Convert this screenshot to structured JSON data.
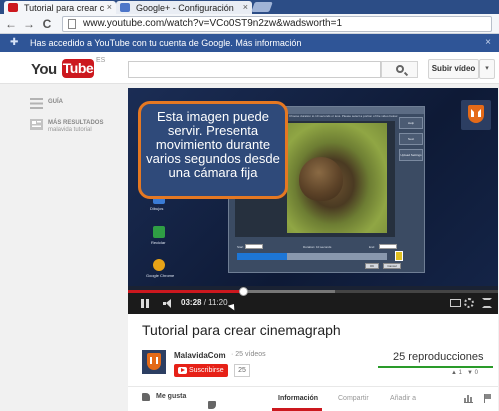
{
  "browser": {
    "tabs": [
      {
        "title": "Tutorial para crear c",
        "favicon_color": "#cc181e",
        "active": true
      },
      {
        "title": "Google+ - Configuración",
        "favicon_color": "#4d76c9",
        "active": false
      }
    ],
    "close_glyph": "×",
    "back_glyph": "←",
    "forward_glyph": "→",
    "reload_glyph": "C",
    "url": "www.youtube.com/watch?v=VCo0ST9n2zw&wadsworth=1"
  },
  "google_banner": {
    "text": "Has accedido a YouTube con tu cuenta de Google. Más información",
    "icon": "puzzle-icon",
    "close_glyph": "×"
  },
  "header": {
    "logo_you": "You",
    "logo_tube": "Tube",
    "logo_region": "ES",
    "upload_label": "Subir vídeo",
    "upload_caret": "▾",
    "brand_color": "#cc181e"
  },
  "guide": {
    "items": [
      {
        "label": "GUÍA",
        "sub": "",
        "icon": "guide-icon"
      },
      {
        "label": "MÁS RESULTADOS",
        "sub": "malavida tutorial",
        "icon": "results-icon"
      }
    ]
  },
  "player": {
    "callout_text": "Esta imagen puede servir. Presenta movimiento durante varios segundos desde una cámara fija",
    "callout_border_color": "#e57822",
    "desktop_icons": [
      {
        "label": "Dibujos",
        "color": "#3a7bd5"
      },
      {
        "label": "Reciclar",
        "color": "#2f9e44"
      },
      {
        "label": "Google Chrome",
        "color": "#e8a317"
      }
    ],
    "app": {
      "hint": "Choose duration to 10 seconds or less. Please select a portion of the video below.",
      "side_buttons": [
        "Help",
        "Next",
        "Upload Settings"
      ],
      "start_label": "Start",
      "duration_label": "Duration: 10 seconds",
      "end_label": "End",
      "ok_label": "OK",
      "cancel_label": "Cancel"
    },
    "time_current": "03:28",
    "time_total": "11:20",
    "progress_played_fraction": 0.31,
    "progress_buffered_fraction": 0.56
  },
  "video": {
    "title": "Tutorial para crear cinemagraph",
    "channel_name": "MalavidaCom",
    "video_count": "25 vídeos",
    "subscribe_label": "Suscribirse",
    "subscriber_count": "25",
    "views": "25 reproducciones",
    "likes": "1",
    "dislikes": "0",
    "like_bar_color": "#2a9b2a"
  },
  "actions": {
    "like_label": "Me gusta",
    "tabs": [
      {
        "label": "Información",
        "active": true
      },
      {
        "label": "Compartir",
        "active": false
      },
      {
        "label": "Añadir a",
        "active": false
      }
    ]
  }
}
